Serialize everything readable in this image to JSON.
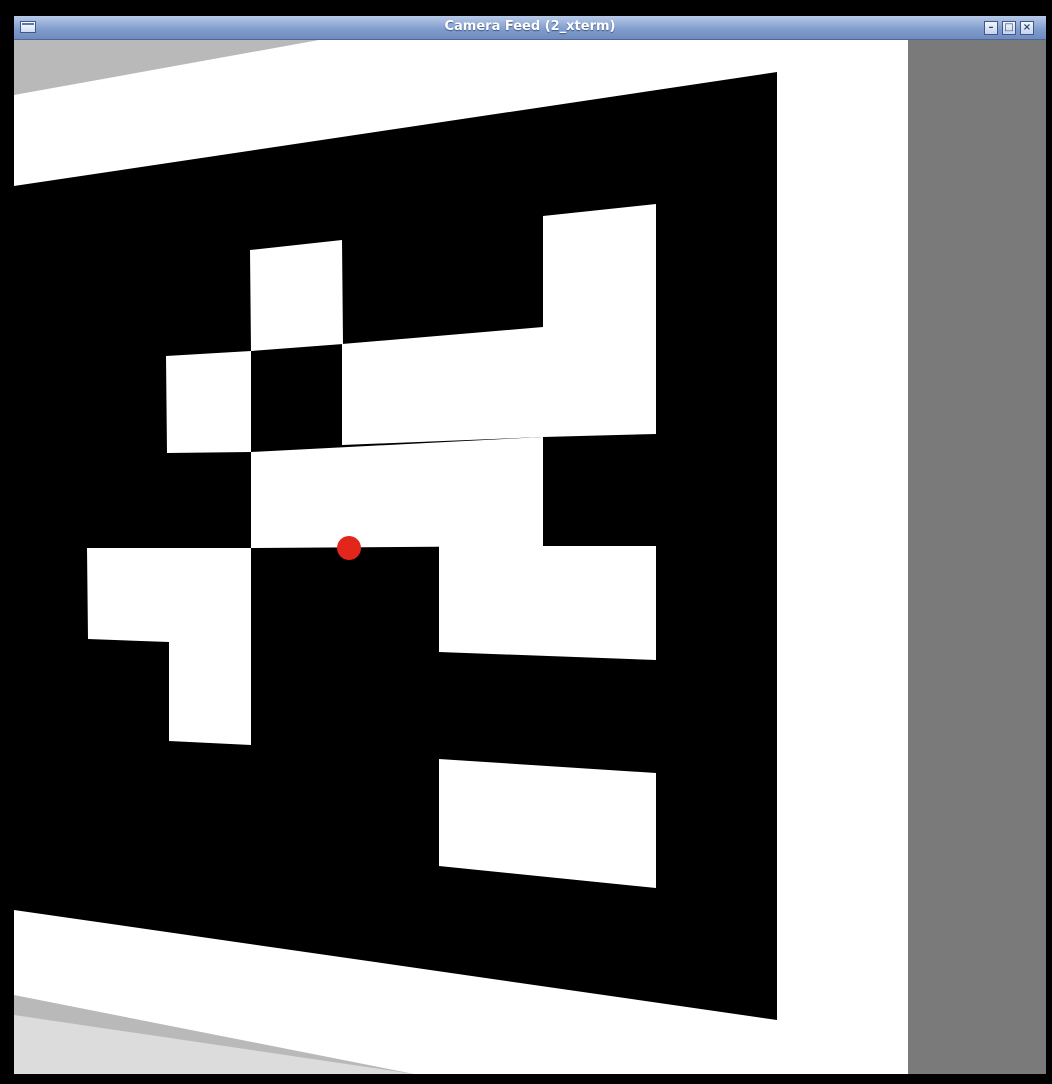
{
  "window": {
    "title": "Camera Feed (2_xterm)",
    "buttons": {
      "minimize": "–",
      "maximize": "□",
      "close": "×"
    }
  },
  "feed": {
    "marker_color": "#000000",
    "background_color": "#ffffff",
    "point_color": "#e3261b",
    "icons": [
      "app-menu-icon",
      "minimize-icon",
      "maximize-icon",
      "close-icon"
    ]
  }
}
